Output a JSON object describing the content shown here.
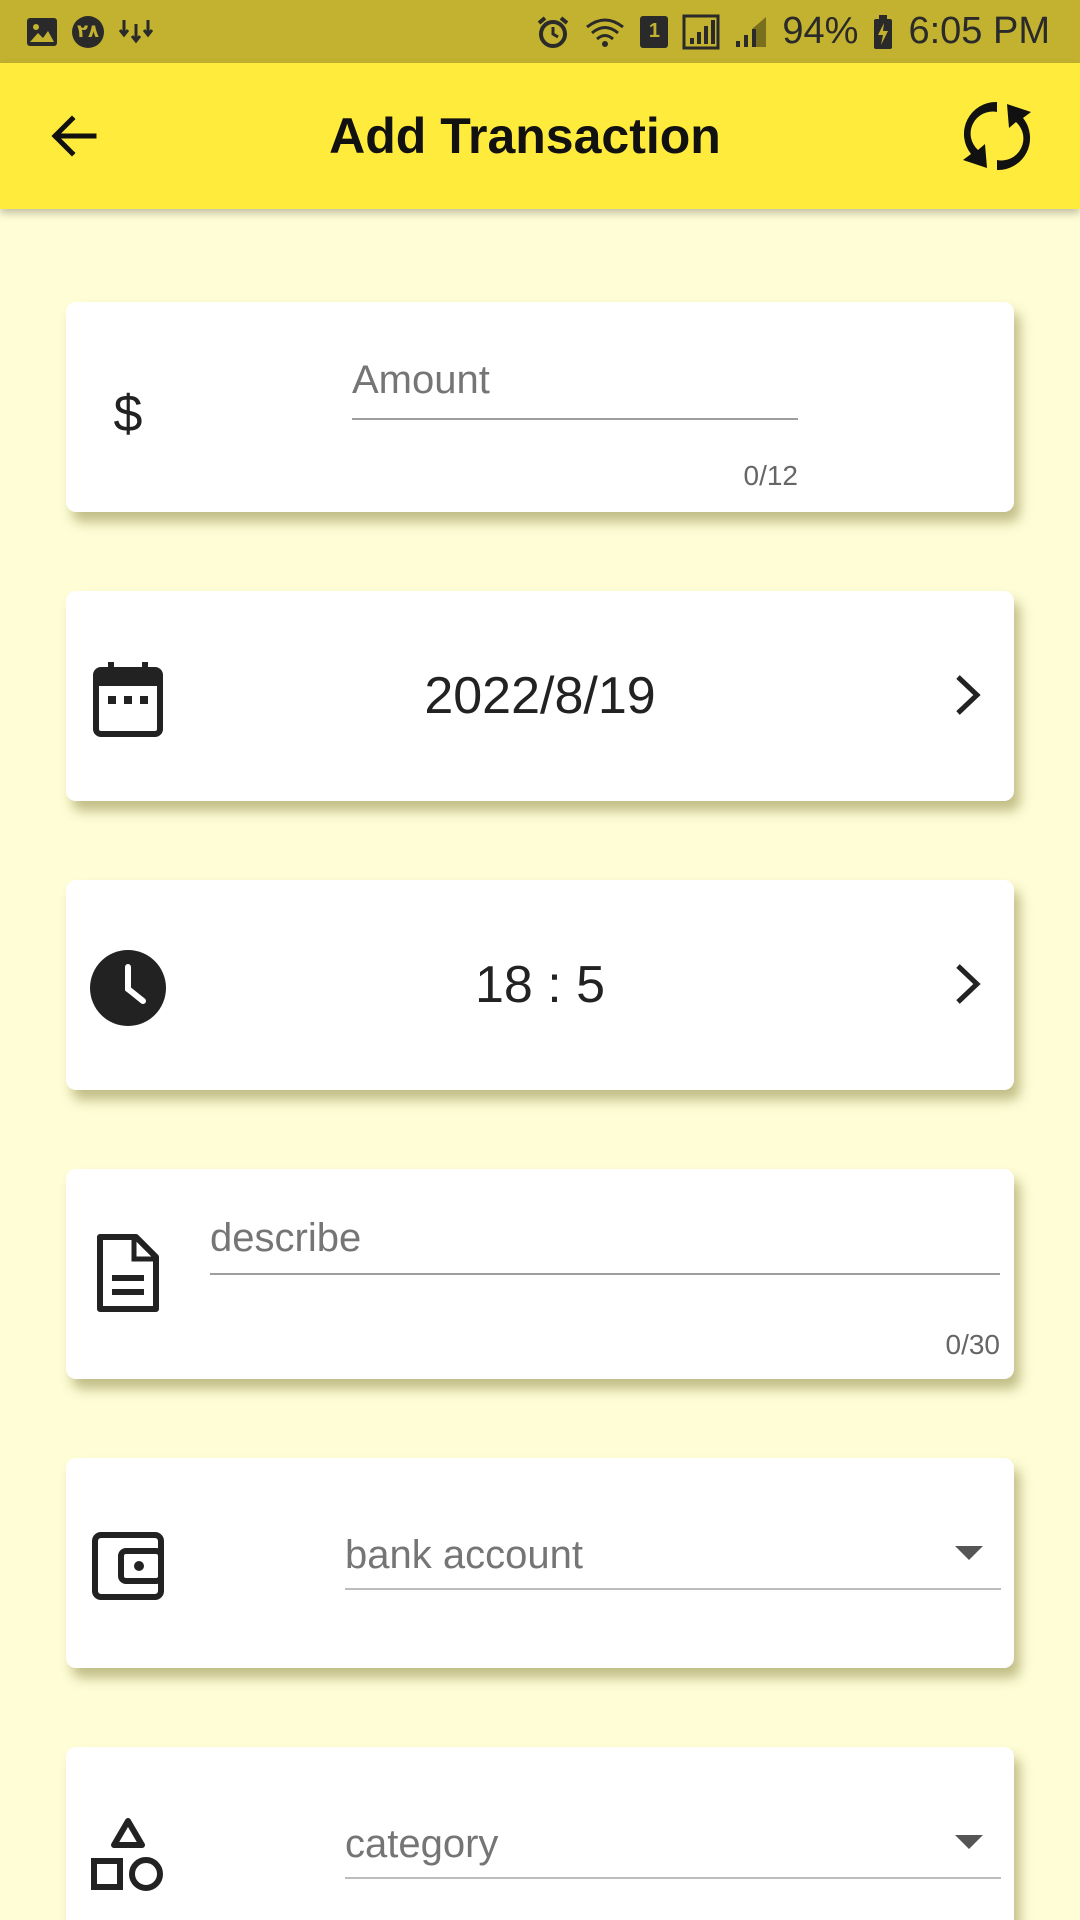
{
  "status_bar": {
    "notif_badge": "٢٨",
    "sim_slot": "1",
    "battery": "94%",
    "time": "6:05 PM"
  },
  "app_bar": {
    "title": "Add Transaction",
    "back_icon": "arrow-back-icon",
    "sync_icon": "sync-icon"
  },
  "amount": {
    "icon": "dollar-icon",
    "symbol": "$",
    "placeholder": "Amount",
    "value": "",
    "counter": "0/12"
  },
  "date": {
    "icon": "calendar-icon",
    "value": "2022/8/19"
  },
  "time": {
    "icon": "clock-icon",
    "value": "18 : 5"
  },
  "describe": {
    "icon": "document-icon",
    "placeholder": "describe",
    "value": "",
    "counter": "0/30"
  },
  "bank_account": {
    "icon": "wallet-icon",
    "label": "bank account"
  },
  "category": {
    "icon": "shapes-icon",
    "label": "category"
  },
  "colors": {
    "status_bar": "#c3b22f",
    "app_bar": "#ffeb3b",
    "background": "#fefdd6",
    "card": "#ffffff"
  }
}
